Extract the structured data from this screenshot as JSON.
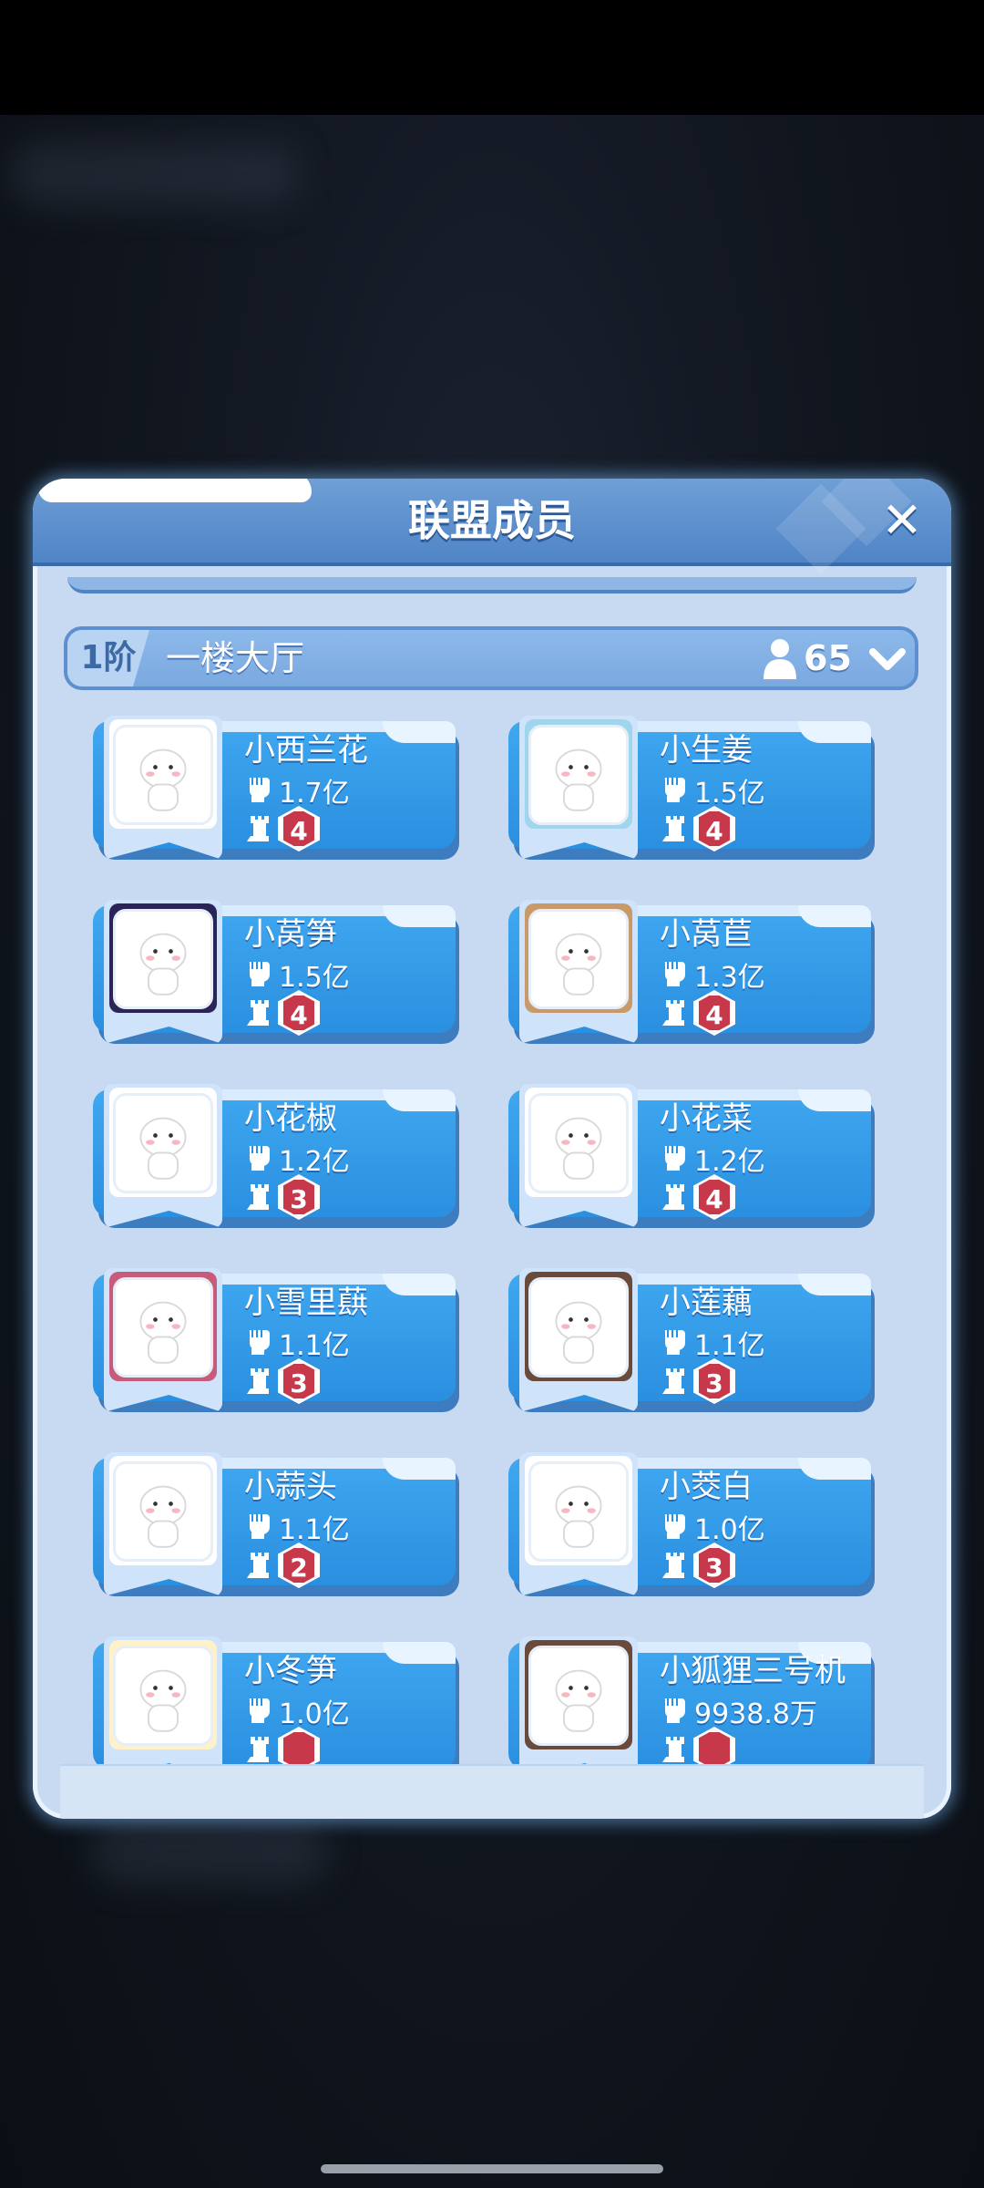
{
  "dialog": {
    "title": "联盟成员",
    "close_icon": "close-icon"
  },
  "floor": {
    "tier": "1阶",
    "name": "一楼大厅",
    "member_count": "65",
    "count_icon": "person-icon",
    "chevron_icon": "chevron-down-icon"
  },
  "members": [
    {
      "name": "小西兰花",
      "power": "1.7亿",
      "level": "4",
      "frame": "plain"
    },
    {
      "name": "小生姜",
      "power": "1.5亿",
      "level": "4",
      "frame": "gaming"
    },
    {
      "name": "小莴笋",
      "power": "1.5亿",
      "level": "4",
      "frame": "2025-night"
    },
    {
      "name": "小莴苣",
      "power": "1.3亿",
      "level": "4",
      "frame": "snowflake"
    },
    {
      "name": "小花椒",
      "power": "1.2亿",
      "level": "3",
      "frame": "plain"
    },
    {
      "name": "小花菜",
      "power": "1.2亿",
      "level": "4",
      "frame": "plain"
    },
    {
      "name": "小雪里蕻",
      "power": "1.1亿",
      "level": "3",
      "frame": "lantern"
    },
    {
      "name": "小莲藕",
      "power": "1.1亿",
      "level": "3",
      "frame": "mushroom"
    },
    {
      "name": "小蒜头",
      "power": "1.1亿",
      "level": "2",
      "frame": "plain"
    },
    {
      "name": "小茭白",
      "power": "1.0亿",
      "level": "3",
      "frame": "plain"
    },
    {
      "name": "小冬笋",
      "power": "1.0亿",
      "level": "",
      "frame": "sun"
    },
    {
      "name": "小狐狸三号机",
      "power": "9938.8万",
      "level": "",
      "frame": "mushroom"
    }
  ],
  "icons": {
    "power": "fist-icon",
    "level": "castle-icon"
  },
  "colors": {
    "panel": "#c7daf1",
    "header": "#5b8dcc",
    "card": "#2f9ae6",
    "badge": "#c6384a"
  }
}
